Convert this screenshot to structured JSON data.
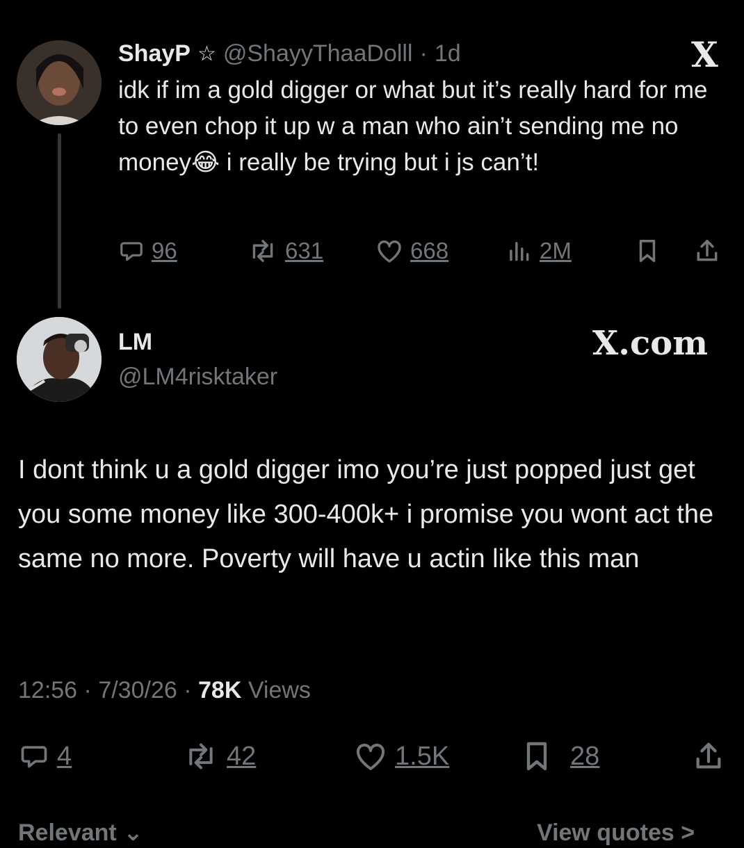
{
  "quoted": {
    "name": "ShayP",
    "badge_symbol": "☆",
    "handle": "@ShayyThaaDolll",
    "time_sep": "·",
    "time": "1d",
    "brand_symbol": "X",
    "text_part1": "idk if im a gold digger or what but it’s really hard for me to even chop it up w a man who ain’t sending me no money",
    "emoji": "😂",
    "text_part2": " i really be trying but i js can’t!",
    "stats": {
      "replies": "96",
      "reposts": "631",
      "likes": "668",
      "views": "2M"
    }
  },
  "reply": {
    "name": "LM",
    "handle": "@LM4risktaker",
    "brand_text": "X.com",
    "text": "I dont think u a gold digger imo you’re just popped just get you some money like 300-400k+ i promise you wont act the same no more. Poverty will have u actin like this man",
    "meta": {
      "time": "12:56",
      "sep": "·",
      "date": "7/30/26",
      "views_count": "78K",
      "views_label": "Views"
    },
    "stats": {
      "replies": "4",
      "reposts": "42",
      "likes": "1.5K",
      "bookmarks": "28"
    }
  },
  "footer": {
    "relevant_label": "Relevant ⌄",
    "view_quotes_label": "View quotes >"
  },
  "colors": {
    "background": "#000000",
    "text": "#e7e9ea",
    "muted": "#71767b"
  }
}
